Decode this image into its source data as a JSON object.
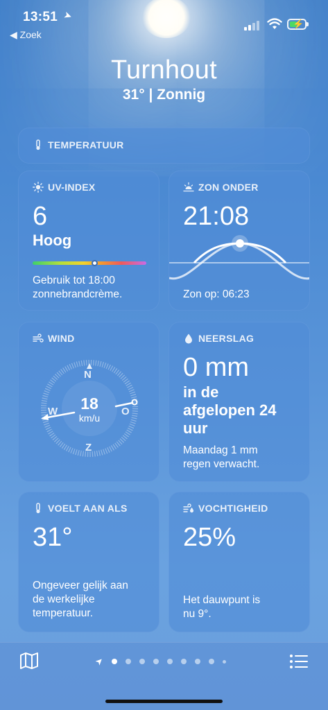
{
  "status_bar": {
    "time": "13:51",
    "back_label": "◀ Zoek"
  },
  "header": {
    "city": "Turnhout",
    "conditions": "31°  |  Zonnig"
  },
  "temperature_card": {
    "label": "TEMPERATUUR"
  },
  "uv": {
    "label": "UV-INDEX",
    "value": "6",
    "level": "Hoog",
    "advice_line1": "Gebruik tot 18:00",
    "advice_line2": "zonnebrandcrème.",
    "scale_fraction": 0.545
  },
  "sunset": {
    "label": "ZON ONDER",
    "time": "21:08",
    "sunrise": "Zon op: 06:23"
  },
  "wind": {
    "label": "WIND",
    "speed": "18",
    "unit": "km/u",
    "compass": {
      "n": "N",
      "e": "O",
      "s": "Z",
      "w": "W"
    }
  },
  "precipitation": {
    "label": "NEERSLAG",
    "amount": "0 mm",
    "period_line1": "in de",
    "period_line2": "afgelopen 24",
    "period_line3": "uur",
    "forecast_line1": "Maandag 1 mm",
    "forecast_line2": "regen verwacht."
  },
  "feels_like": {
    "label": "VOELT AAN ALS",
    "value": "31°",
    "desc_line1": "Ongeveer gelijk aan",
    "desc_line2": "de werkelijke",
    "desc_line3": "temperatuur."
  },
  "humidity": {
    "label": "VOCHTIGHEID",
    "value": "25%",
    "desc_line1": "Het dauwpunt is",
    "desc_line2": "nu 9°."
  },
  "bottom_nav": {
    "map_icon": "map-icon",
    "list_icon": "list-icon",
    "page_count": 9
  },
  "colors": {
    "sky": "#4a89d2",
    "card": "#508cd7",
    "uv_indicator_ring": "#3b6db0"
  }
}
